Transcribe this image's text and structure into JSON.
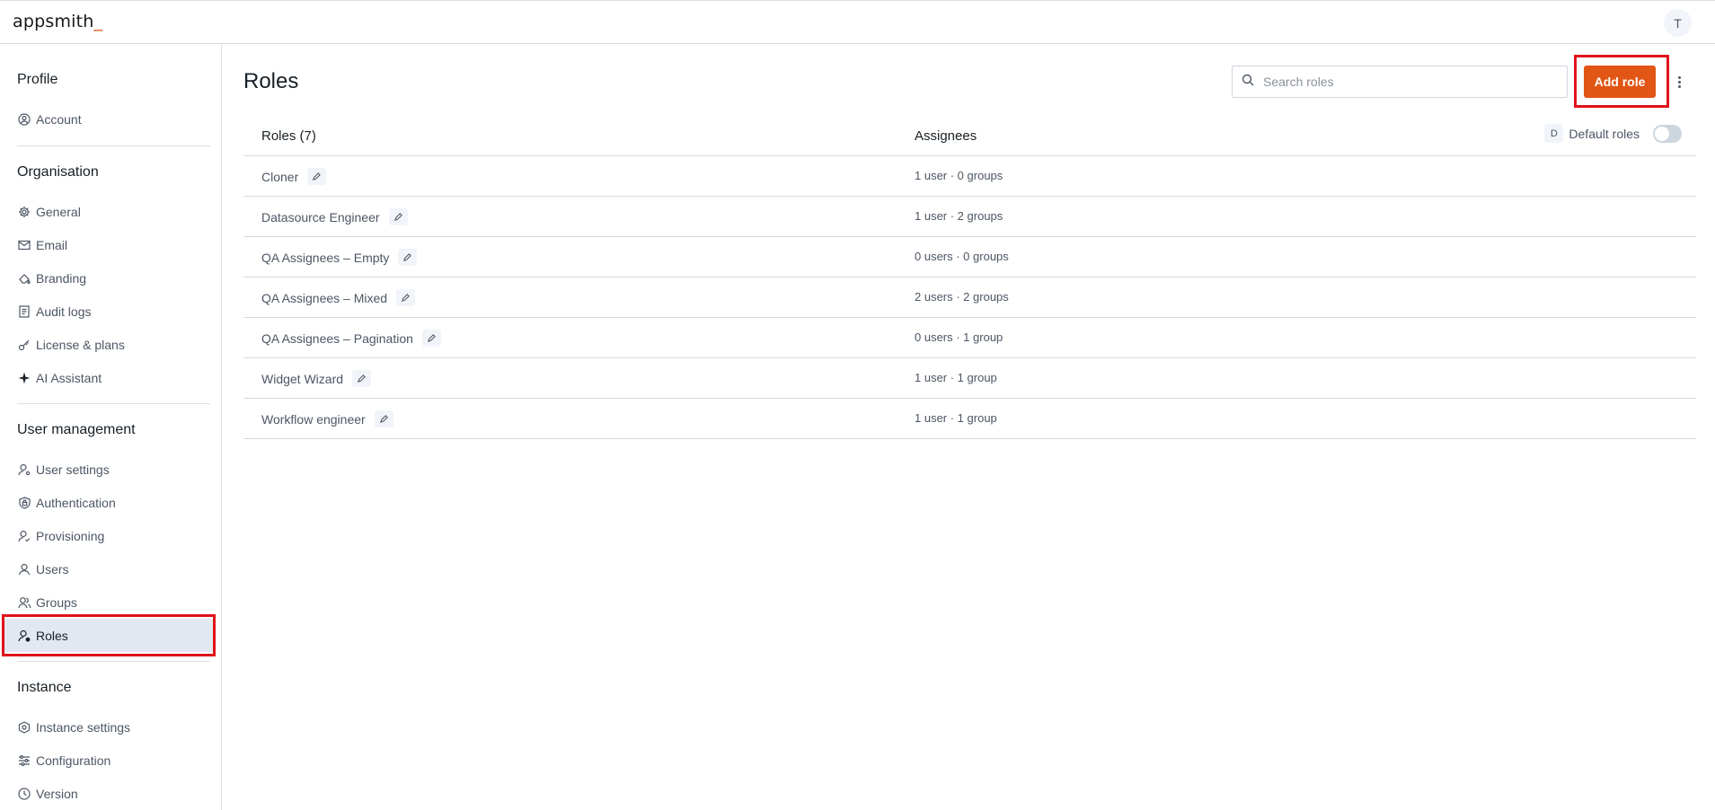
{
  "app": {
    "logo_text": "appsmith",
    "logo_cursor": "_",
    "avatar_initial": "T"
  },
  "sidebar": {
    "sections": [
      {
        "title": "Profile",
        "items": [
          {
            "label": "Account",
            "icon": "user-circle-icon"
          }
        ]
      },
      {
        "title": "Organisation",
        "items": [
          {
            "label": "General",
            "icon": "gear-icon"
          },
          {
            "label": "Email",
            "icon": "mail-icon"
          },
          {
            "label": "Branding",
            "icon": "paint-bucket-icon"
          },
          {
            "label": "Audit logs",
            "icon": "file-list-icon"
          },
          {
            "label": "License & plans",
            "icon": "key-icon"
          },
          {
            "label": "AI Assistant",
            "icon": "sparkle-icon"
          }
        ]
      },
      {
        "title": "User management",
        "items": [
          {
            "label": "User settings",
            "icon": "user-gear-icon"
          },
          {
            "label": "Authentication",
            "icon": "shield-lock-icon"
          },
          {
            "label": "Provisioning",
            "icon": "user-check-icon"
          },
          {
            "label": "Users",
            "icon": "user-icon"
          },
          {
            "label": "Groups",
            "icon": "users-icon"
          },
          {
            "label": "Roles",
            "icon": "user-role-icon",
            "active": true
          }
        ]
      },
      {
        "title": "Instance",
        "items": [
          {
            "label": "Instance settings",
            "icon": "hexagon-gear-icon"
          },
          {
            "label": "Configuration",
            "icon": "sliders-icon"
          },
          {
            "label": "Version",
            "icon": "clock-icon"
          }
        ]
      }
    ]
  },
  "main": {
    "title": "Roles",
    "search": {
      "placeholder": "Search roles",
      "value": ""
    },
    "add_button": "Add role",
    "table": {
      "col_roles": "Roles (7)",
      "col_assignees": "Assignees",
      "default_roles_key": "D",
      "default_roles_label": "Default roles",
      "default_roles_enabled": false,
      "rows": [
        {
          "name": "Cloner",
          "assignees": "1 user · 0 groups"
        },
        {
          "name": "Datasource Engineer",
          "assignees": "1 user · 2 groups"
        },
        {
          "name": "QA Assignees – Empty",
          "assignees": "0 users · 0 groups"
        },
        {
          "name": "QA Assignees – Mixed",
          "assignees": "2 users · 2 groups"
        },
        {
          "name": "QA Assignees – Pagination",
          "assignees": "0 users · 1 group"
        },
        {
          "name": "Widget Wizard",
          "assignees": "1 user · 1 group"
        },
        {
          "name": "Workflow engineer",
          "assignees": "1 user · 1 group"
        }
      ]
    }
  },
  "colors": {
    "accent": "#e15615",
    "highlight": "#e0121b",
    "active_bg": "#e2e8f0"
  }
}
